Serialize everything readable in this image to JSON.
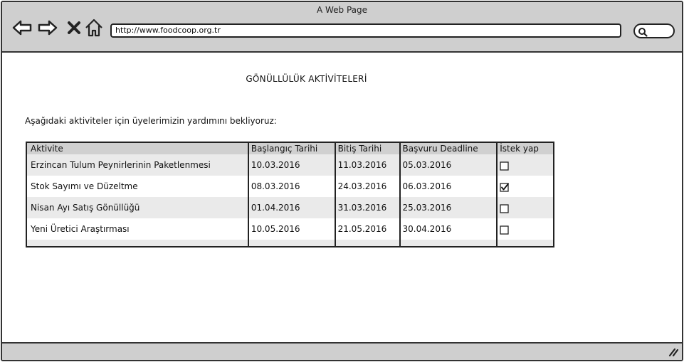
{
  "browser": {
    "window_title": "A Web Page",
    "url": "http://www.foodcoop.org.tr",
    "icons": [
      "back-icon",
      "forward-icon",
      "stop-icon",
      "home-icon",
      "search-icon",
      "resize-grip-icon"
    ]
  },
  "page": {
    "title": "GÖNÜLLÜLÜK AKTİVİTELERİ",
    "intro": "Aşağıdaki aktiviteler için üyelerimizin yardımını bekliyoruz:"
  },
  "table": {
    "headers": [
      "Aktivite",
      "Başlangıç Tarihi",
      "Bitiş Tarihi",
      "Başvuru Deadline",
      "İstek yap"
    ],
    "rows": [
      {
        "activity": "Erzincan Tulum Peynirlerinin Paketlenmesi",
        "start": "10.03.2016",
        "end": "11.03.2016",
        "deadline": "05.03.2016",
        "requested": false
      },
      {
        "activity": "Stok Sayımı ve Düzeltme",
        "start": "08.03.2016",
        "end": "24.03.2016",
        "deadline": "06.03.2016",
        "requested": true
      },
      {
        "activity": "Nisan Ayı Satış Gönüllüğü",
        "start": "01.04.2016",
        "end": "31.03.2016",
        "deadline": "25.03.2016",
        "requested": false
      },
      {
        "activity": "Yeni Üretici Araştırması",
        "start": "10.05.2016",
        "end": "21.05.2016",
        "deadline": "30.04.2016",
        "requested": false
      }
    ]
  }
}
